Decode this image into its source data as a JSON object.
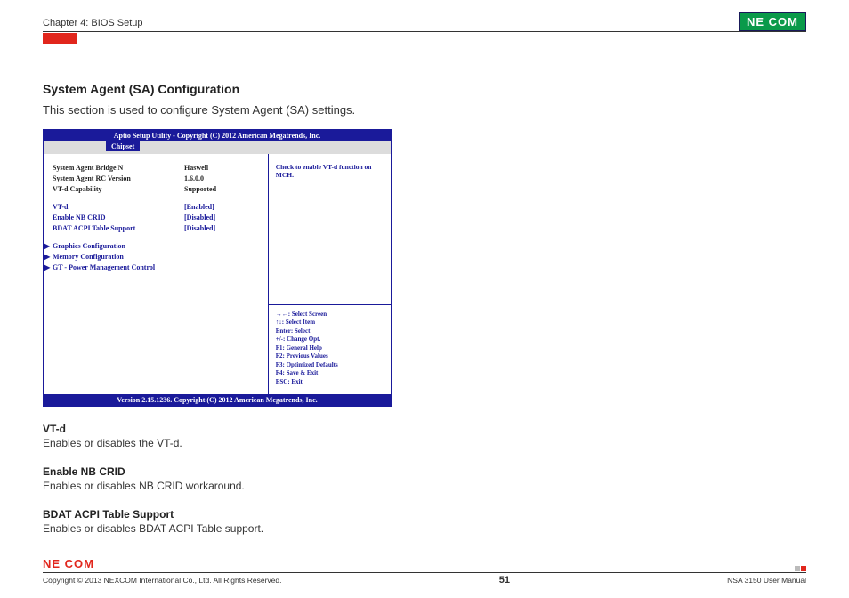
{
  "header": {
    "chapter": "Chapter 4: BIOS Setup",
    "brand": "NE COM"
  },
  "section": {
    "title": "System Agent (SA) Configuration",
    "subtitle": "This section is used to configure System Agent (SA) settings."
  },
  "bios": {
    "title": "Aptio Setup Utility - Copyright (C) 2012 American Megatrends, Inc.",
    "tab": "Chipset",
    "rows_info": [
      {
        "label": "System Agent Bridge N",
        "value": "Haswell"
      },
      {
        "label": "System Agent RC Version",
        "value": "1.6.0.0"
      },
      {
        "label": "VT-d Capability",
        "value": "Supported"
      }
    ],
    "rows_opts": [
      {
        "label": "VT-d",
        "value": "[Enabled]"
      },
      {
        "label": "Enable NB CRID",
        "value": "[Disabled]"
      },
      {
        "label": "BDAT ACPI Table Support",
        "value": "[Disabled]"
      }
    ],
    "submenus": [
      "Graphics Configuration",
      "Memory Configuration",
      "GT - Power Management Control"
    ],
    "help": "Check to enable VT-d function on MCH.",
    "keys": [
      "→←: Select Screen",
      "↑↓: Select Item",
      "Enter: Select",
      "+/-: Change Opt.",
      "F1: General Help",
      "F2: Previous Values",
      "F3: Optimized Defaults",
      "F4: Save & Exit",
      "ESC: Exit"
    ],
    "footer": "Version 2.15.1236. Copyright (C) 2012 American Megatrends, Inc."
  },
  "descriptions": [
    {
      "title": "VT-d",
      "text": "Enables or disables the VT-d."
    },
    {
      "title": "Enable NB CRID",
      "text": "Enables or disables NB CRID workaround."
    },
    {
      "title": "BDAT ACPI Table Support",
      "text": "Enables or disables BDAT ACPI Table support."
    }
  ],
  "footer": {
    "brand": "NE COM",
    "copyright": "Copyright © 2013 NEXCOM International Co., Ltd. All Rights Reserved.",
    "page": "51",
    "doc": "NSA 3150 User Manual"
  }
}
